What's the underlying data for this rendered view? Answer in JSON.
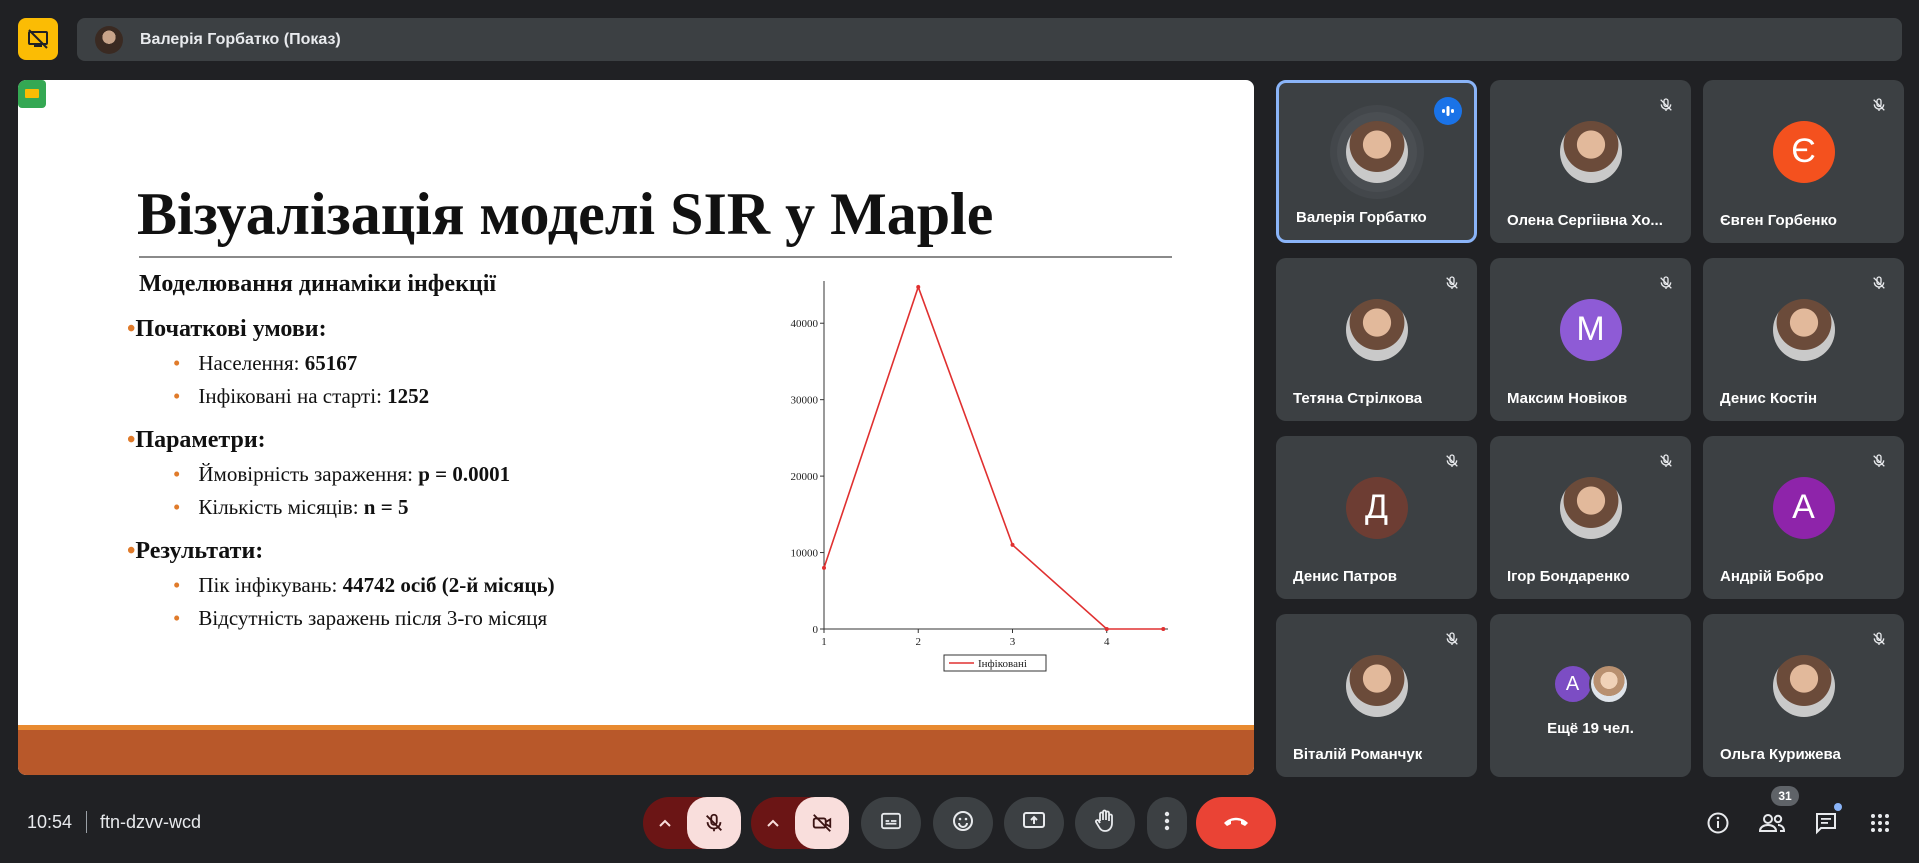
{
  "header": {
    "presenter_label": "Валерія Горбатко (Показ)"
  },
  "slide": {
    "title": "Візуалізація моделі SIR у Maple",
    "subtitle": "Моделювання динаміки інфекції",
    "sections": [
      {
        "heading": "Початкові умови:",
        "items": [
          {
            "text": "Населення: ",
            "bold": "65167"
          },
          {
            "text": "Інфіковані на старті: ",
            "bold": "1252"
          }
        ]
      },
      {
        "heading": "Параметри:",
        "items": [
          {
            "text": "Ймовірність зараження: ",
            "bold": "p = 0.0001"
          },
          {
            "text": "Кількість місяців: ",
            "bold": "n = 5"
          }
        ]
      },
      {
        "heading": "Результати:",
        "items": [
          {
            "text": "Пік інфікувань: ",
            "bold": "44742 осіб (2-й місяць)"
          },
          {
            "text": "Відсутність заражень після 3-го місяця",
            "bold": ""
          }
        ]
      }
    ]
  },
  "chart_data": {
    "type": "line",
    "x": [
      1,
      2,
      3,
      4,
      4.6
    ],
    "series": [
      {
        "name": "Інфіковані",
        "values": [
          8000,
          44742,
          11000,
          0,
          0
        ],
        "color": "#e03030"
      }
    ],
    "xticks": [
      "1",
      "2",
      "3",
      "4"
    ],
    "yticks": [
      "0",
      "10000",
      "20000",
      "30000",
      "40000"
    ],
    "xlim": [
      1,
      4.65
    ],
    "ylim": [
      0,
      45000
    ],
    "legend": "bottom-center"
  },
  "participants": [
    {
      "name": "Валерія Горбатко",
      "kind": "photo",
      "active": true,
      "speaking": true
    },
    {
      "name": "Олена Сергіівна Хо...",
      "kind": "photo",
      "muted": true
    },
    {
      "name": "Євген Горбенко",
      "kind": "letter",
      "letter": "Є",
      "color": "#f4511e",
      "muted": true
    },
    {
      "name": "Тетяна Стрілкова",
      "kind": "photo",
      "muted": true
    },
    {
      "name": "Максим Новіков",
      "kind": "letter",
      "letter": "М",
      "color": "#8e5bd6",
      "muted": true
    },
    {
      "name": "Денис Костін",
      "kind": "photo",
      "muted": true
    },
    {
      "name": "Денис Патров",
      "kind": "letter",
      "letter": "Д",
      "color": "#6d3d33",
      "muted": true
    },
    {
      "name": "Ігор Бондаренко",
      "kind": "photo",
      "muted": true
    },
    {
      "name": "Андрій Бобро",
      "kind": "letter",
      "letter": "А",
      "color": "#8e24aa",
      "muted": true
    },
    {
      "name": "Віталій Романчук",
      "kind": "photo",
      "muted": true
    },
    {
      "name": "Ещё 19 чел.",
      "kind": "more",
      "letter": "A"
    },
    {
      "name": "Ольга Курижева",
      "kind": "photo",
      "muted": true
    }
  ],
  "footer": {
    "time": "10:54",
    "meeting_code": "ftn-dzvv-wcd",
    "people_count": "31"
  },
  "icons": {
    "present": "present-screen-off-icon",
    "mic": "mic-off-icon",
    "camera": "camera-off-icon",
    "captions": "captions-icon",
    "emoji": "emoji-icon",
    "share": "present-now-icon",
    "hand": "raise-hand-icon",
    "more": "more-vert-icon",
    "end": "call-end-icon",
    "info": "info-icon",
    "people": "people-icon",
    "chat": "chat-icon",
    "activities": "apps-icon"
  }
}
